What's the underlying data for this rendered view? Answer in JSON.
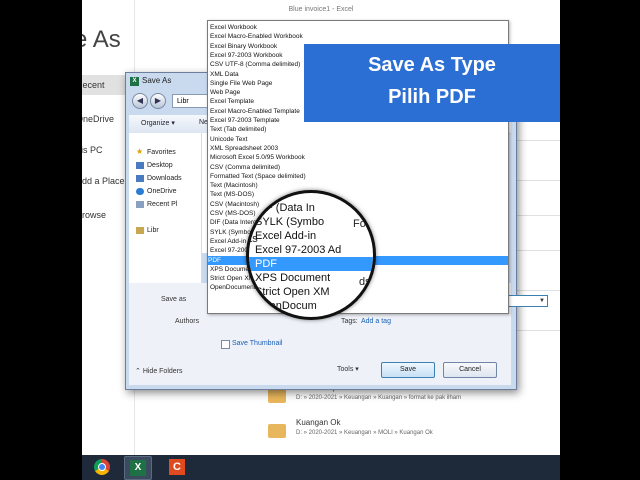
{
  "backstage": {
    "window_title": "Blue invoice1  -  Excel",
    "heading": "e As",
    "nav": [
      "Recent",
      "OneDrive",
      "his PC",
      "Add a Place",
      "Browse"
    ],
    "files": [
      {
        "name": "format-ke-pak-ilham",
        "path": "D: » 2020-2021 » Keuangan » Kuangan » format ke pak ilham"
      },
      {
        "name": "Kuangan Ok",
        "path": "D: » 2020-2021 » Keuangan » MOLI » Kuangan Ok"
      }
    ]
  },
  "dialog": {
    "title": "Save As",
    "address": "Libr",
    "toolbar": {
      "organize": "Organize ▾",
      "new_folder": "Ne"
    },
    "nav_pane": [
      "Favorites",
      "Desktop",
      "Downloads",
      "OneDrive",
      "Recent Pl",
      "Libr"
    ],
    "save_as_label": "Save as",
    "save_name_label": "me:",
    "authors_label": "Authors",
    "tags_label": "Tags:",
    "tags_link": "Add a tag",
    "save_thumbnail": "Save Thumbnail",
    "hide_folders": "Hide Folders",
    "tools": "Tools",
    "save_btn": "Save",
    "cancel_btn": "Cancel"
  },
  "save_type_list": [
    "Excel Workbook",
    "Excel Macro-Enabled Workbook",
    "Excel Binary Workbook",
    "Excel 97-2003 Workbook",
    "CSV UTF-8 (Comma delimited)",
    "XML Data",
    "Single File Web Page",
    "Web Page",
    "Excel Template",
    "Excel Macro-Enabled Template",
    "Excel 97-2003 Template",
    "Text (Tab delimited)",
    "Unicode Text",
    "XML Spreadsheet 2003",
    "Microsoft Excel 5.0/95 Workbook",
    "CSV (Comma delimited)",
    "Formatted Text (Space delimited)",
    "Text (Macintosh)",
    "Text (MS-DOS)",
    "CSV (Macintosh)",
    "CSV (MS-DOS)",
    "DIF (Data Interchange Format)",
    "SYLK (Symbolic Link)",
    "Excel Add-in",
    "Excel 97-2003 Add-in",
    "PDF",
    "XPS Document",
    "Strict Open XML Spreadsheet",
    "OpenDocument Spreadsheet"
  ],
  "selected_index": 25,
  "magnifier": {
    "items": [
      "DIF (Data In",
      "SYLK (Symbo",
      "Excel Add-in",
      "Excel 97-2003 Ad",
      "PDF",
      "XPS Document",
      "Strict Open XM",
      "OpenDocum"
    ],
    "behind": [
      "ents",
      "me:",
      "Format)",
      "dsheet",
      "dsheet"
    ]
  },
  "banner": {
    "line1": "Save As Type",
    "line2": "Pilih PDF"
  },
  "taskbar": [
    "chrome-icon",
    "excel-icon",
    "camtasia-icon"
  ],
  "colors": {
    "banner": "#2b6fd4",
    "selection": "#3399ff",
    "excel": "#1e7145"
  }
}
